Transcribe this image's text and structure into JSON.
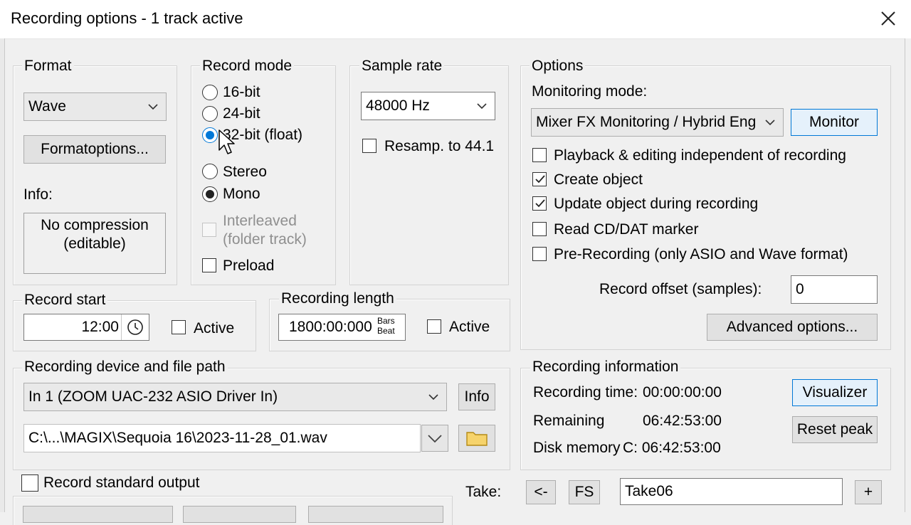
{
  "window": {
    "title": "Recording options - 1 track active",
    "close_icon": "close-icon"
  },
  "format": {
    "group_label": "Format",
    "selected": "Wave",
    "format_options_button": "Formatoptions...",
    "info_label": "Info:",
    "info_line1": "No compression",
    "info_line2": "(editable)"
  },
  "record_mode": {
    "group_label": "Record mode",
    "bit_options": [
      "16-bit",
      "24-bit",
      "32-bit (float)"
    ],
    "selected_bit": "32-bit (float)",
    "channel_options": [
      "Stereo",
      "Mono"
    ],
    "selected_channel": "Mono",
    "interleaved_line1": "Interleaved",
    "interleaved_line2": "(folder track)",
    "preload": "Preload"
  },
  "sample_rate": {
    "group_label": "Sample rate",
    "selected": "48000 Hz",
    "resample_label": "Resamp. to 44.1"
  },
  "options": {
    "group_label": "Options",
    "monitoring_label": "Monitoring mode:",
    "monitoring_selected": "Mixer FX Monitoring / Hybrid Eng",
    "monitor_button": "Monitor",
    "checkboxes": [
      {
        "label": "Playback & editing independent of recording",
        "checked": false
      },
      {
        "label": "Create object",
        "checked": true
      },
      {
        "label": "Update object during recording",
        "checked": true
      },
      {
        "label": "Read CD/DAT marker",
        "checked": false
      },
      {
        "label": "Pre-Recording (only ASIO and Wave format)",
        "checked": false
      }
    ],
    "offset_label": "Record offset (samples):",
    "offset_value": "0",
    "advanced_button": "Advanced options..."
  },
  "record_start": {
    "group_label": "Record start",
    "time_value": "12:00",
    "clock_icon": "clock-icon",
    "active_label": "Active"
  },
  "recording_length": {
    "group_label": "Recording length",
    "value": "1800:00:000",
    "unit_top": "Bars",
    "unit_bottom": "Beat",
    "active_label": "Active"
  },
  "device": {
    "group_label": "Recording device and file path",
    "device_selected": "In 1 (ZOOM UAC-232 ASIO Driver In)",
    "info_button": "Info",
    "file_path": "C:\\...\\MAGIX\\Sequoia 16\\2023-11-28_01.wav",
    "folder_icon": "folder-icon"
  },
  "recording_info": {
    "group_label": "Recording information",
    "time_label": "Recording time:",
    "time_value": "00:00:00:00",
    "remaining_label": "Remaining",
    "remaining_value": "06:42:53:00",
    "disk_label": "Disk memory",
    "disk_value": "C: 06:42:53:00",
    "visualizer_button": "Visualizer",
    "reset_peak_button": "Reset peak"
  },
  "bottom": {
    "record_standard_output": "Record standard output",
    "take_label": "Take:",
    "prev_button": "<-",
    "fs_button": "FS",
    "take_value": "Take06",
    "plus_button": "+"
  },
  "colors": {
    "accent": "#0078d7",
    "background": "#f0f0f0",
    "button": "#e1e1e1"
  }
}
